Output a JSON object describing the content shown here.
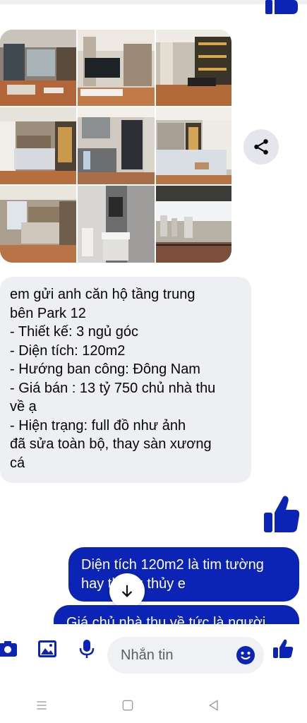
{
  "colors": {
    "accent": "#0b24b5",
    "incoming_bubble": "#eeeff2",
    "share_button_bg": "#e4e6eb"
  },
  "gallery": {
    "photos": [
      "living-room-photo",
      "living-tv-photo",
      "dining-room-photo",
      "bedroom-photo",
      "kitchen-photo",
      "master-bedroom-photo",
      "bedroom-window-photo",
      "bathroom-photo",
      "balcony-view-photo"
    ]
  },
  "share": {
    "icon": "share-icon"
  },
  "incoming_message": {
    "lines": [
      "em gửi anh căn hộ tầng trung\nbên Park 12",
      "- Thiết kế: 3 ngủ góc",
      "- Diện tích: 120m2",
      "- Hướng ban công: Đông Nam",
      "- Giá bán : 13 tỷ 750 chủ nhà thu\nvề ạ",
      "- Hiện trạng: full đồ như ảnh\nđã sửa toàn bộ, thay sàn xương\ncá"
    ]
  },
  "reaction": {
    "icon": "thumbs-up-icon"
  },
  "outgoing_messages": [
    {
      "text": "Diện tích 120m2 là tim tường hay thông thủy e"
    },
    {
      "text": "Giá chủ nhà thu về tức là người"
    }
  ],
  "scroll_button": {
    "icon": "arrow-down-icon"
  },
  "composer": {
    "placeholder": "Nhắn tin",
    "icons": [
      "camera-icon",
      "gallery-icon",
      "microphone-icon",
      "emoji-icon",
      "thumbs-up-icon"
    ]
  },
  "system_nav": {
    "icons": [
      "recents-icon",
      "home-icon",
      "back-icon"
    ]
  }
}
